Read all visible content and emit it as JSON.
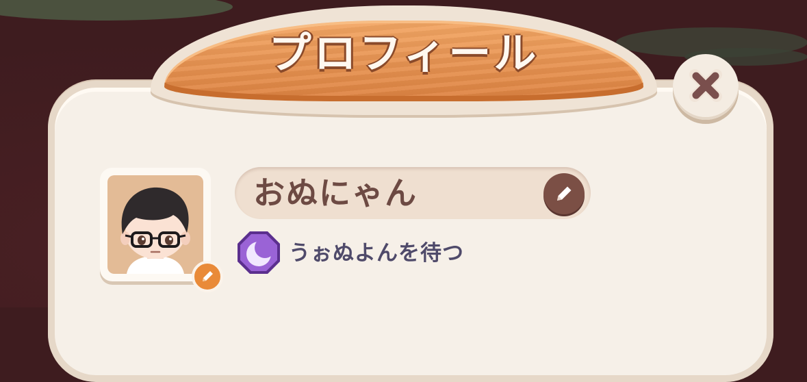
{
  "header": {
    "title": "プロフィール"
  },
  "profile": {
    "name": "おぬにゃん",
    "status_text": "うぉぬよんを待つ"
  },
  "icons": {
    "close": "close-icon",
    "name_edit": "pencil-icon",
    "avatar_edit": "pencil-icon",
    "status": "moon-icon"
  },
  "colors": {
    "banner": "#e8924d",
    "panel": "#f6f0e8",
    "name_text": "#6d4a43",
    "status_text": "#4f4a6a",
    "badge": "#8a55c8",
    "edit_button": "#7b4f45",
    "avatar_edit_button": "#e98a38",
    "background": "#3e1c1f"
  }
}
